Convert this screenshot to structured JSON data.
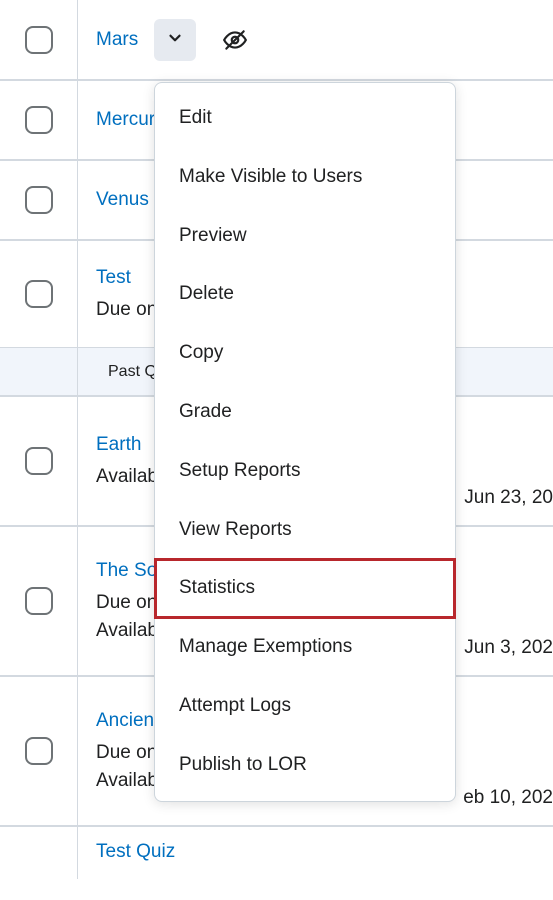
{
  "rows": [
    {
      "title": "Mars",
      "has_caret": true,
      "has_hidden": true
    },
    {
      "title": "Mercury"
    },
    {
      "title": "Venus"
    },
    {
      "title": "Test",
      "due": "Due on"
    }
  ],
  "category": {
    "label": "Past Quizzes"
  },
  "rows2": [
    {
      "title": "Earth",
      "avail": "Available",
      "date": "Jun 23, 20"
    },
    {
      "title": "The Solar",
      "due": "Due on",
      "avail": "Available",
      "date": "Jun 3, 202"
    },
    {
      "title": "Ancient",
      "due": "Due on",
      "avail": "Available",
      "date": "eb 10, 202"
    }
  ],
  "cutoff_title": "Test Quiz",
  "menu": {
    "items": [
      "Edit",
      "Make Visible to Users",
      "Preview",
      "Delete",
      "Copy",
      "Grade",
      "Setup Reports",
      "View Reports",
      "Statistics",
      "Manage Exemptions",
      "Attempt Logs",
      "Publish to LOR"
    ],
    "highlighted_index": 8
  }
}
